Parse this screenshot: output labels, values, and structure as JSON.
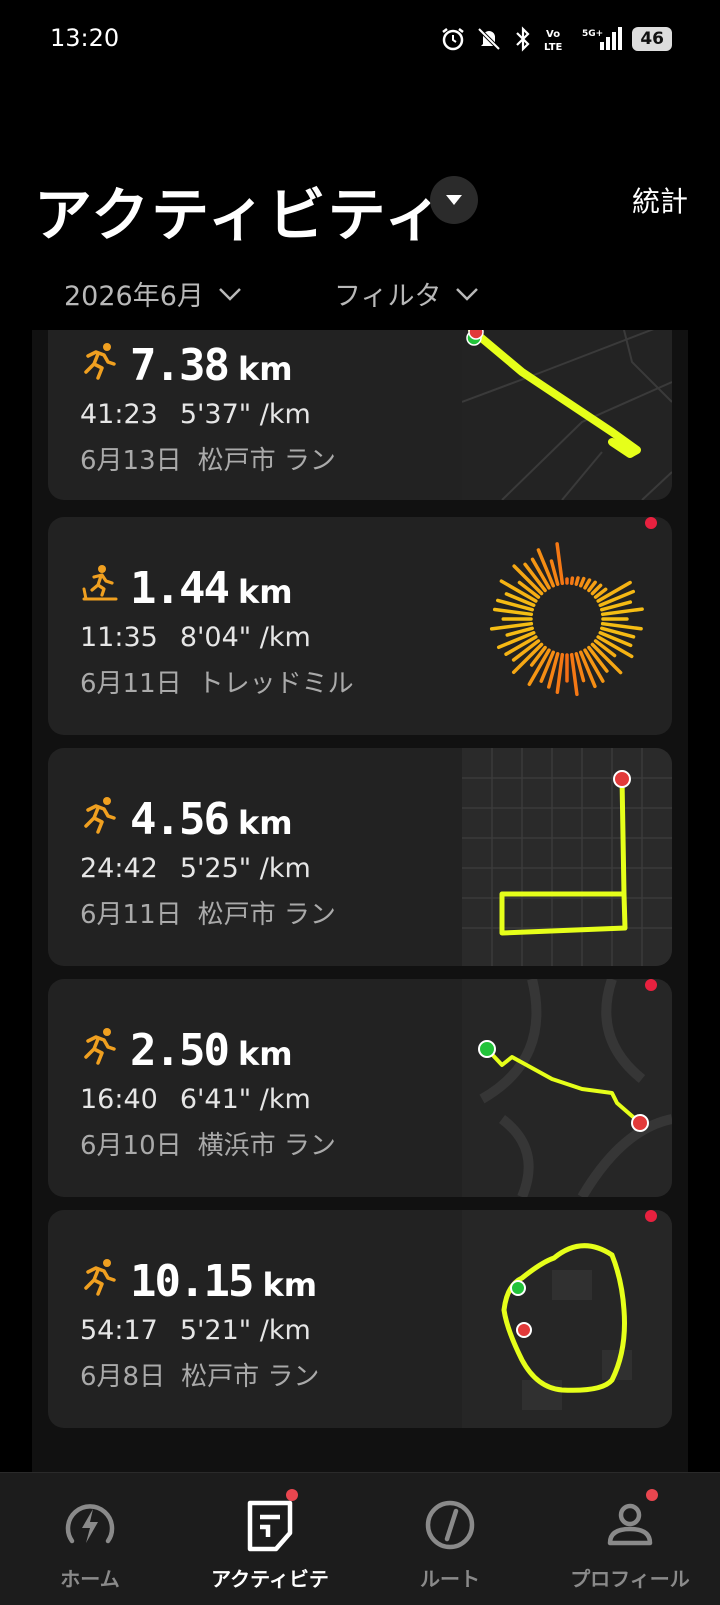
{
  "status_bar": {
    "time": "13:20",
    "battery": "46"
  },
  "header": {
    "title": "アクティビティ",
    "stats_label": "統計"
  },
  "filters": {
    "month": "2026年6月",
    "filter": "フィルタ"
  },
  "activities": [
    {
      "type": "run",
      "icon": "running-icon",
      "distance": "7.38",
      "unit": "km",
      "duration": "41:23",
      "pace": "5'37\" /km",
      "date": "6月13日",
      "title": "松戸市 ラン",
      "unread": false
    },
    {
      "type": "treadmill",
      "icon": "treadmill-icon",
      "distance": "1.44",
      "unit": "km",
      "duration": "11:35",
      "pace": "8'04\" /km",
      "date": "6月11日",
      "title": "トレッドミル",
      "unread": true
    },
    {
      "type": "run",
      "icon": "running-icon",
      "distance": "4.56",
      "unit": "km",
      "duration": "24:42",
      "pace": "5'25\" /km",
      "date": "6月11日",
      "title": "松戸市 ラン",
      "unread": false
    },
    {
      "type": "run",
      "icon": "running-icon",
      "distance": "2.50",
      "unit": "km",
      "duration": "16:40",
      "pace": "6'41\" /km",
      "date": "6月10日",
      "title": "横浜市 ラン",
      "unread": true
    },
    {
      "type": "run",
      "icon": "running-icon",
      "distance": "10.15",
      "unit": "km",
      "duration": "54:17",
      "pace": "5'21\" /km",
      "date": "6月8日",
      "title": "松戸市 ラン",
      "unread": true
    }
  ],
  "bottom_nav": [
    {
      "label": "ホーム",
      "icon": "home-bolt-icon",
      "active": false,
      "badge": false
    },
    {
      "label": "アクティビテ",
      "icon": "activity-icon",
      "active": true,
      "badge": true
    },
    {
      "label": "ルート",
      "icon": "compass-icon",
      "active": false,
      "badge": false
    },
    {
      "label": "プロフィール",
      "icon": "profile-icon",
      "active": false,
      "badge": true
    }
  ],
  "colors": {
    "accent_orange": "#f0a020",
    "route_yellow": "#e6ff1a",
    "badge_red": "#e8213f",
    "card_bg": "#222222"
  }
}
